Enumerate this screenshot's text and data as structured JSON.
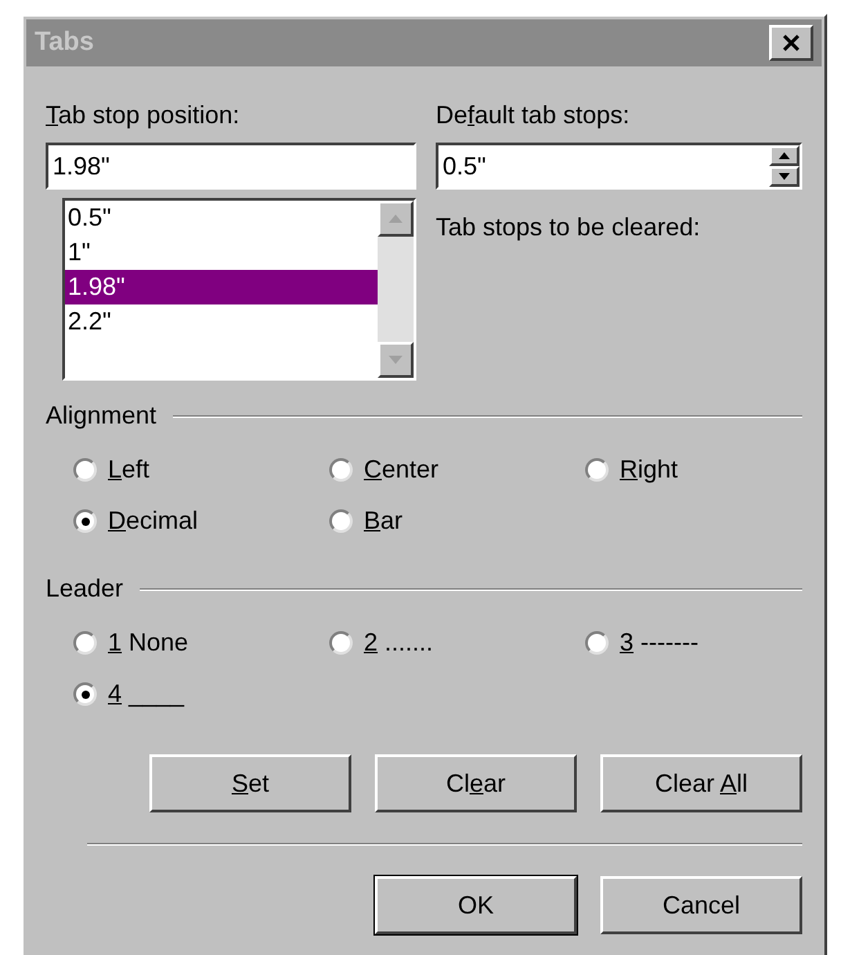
{
  "window": {
    "title": "Tabs",
    "active": false
  },
  "tab_stop_position": {
    "label": [
      {
        "text": "T",
        "underlined": true
      },
      {
        "text": "ab stop position:",
        "underlined": false
      }
    ],
    "value": "1.98\""
  },
  "tab_stops": [
    {
      "label": "0.5\"",
      "selected": false
    },
    {
      "label": "1\"",
      "selected": false
    },
    {
      "label": "1.98\"",
      "selected": true
    },
    {
      "label": "2.2\"",
      "selected": false
    }
  ],
  "default_tab_stops": {
    "label": [
      {
        "text": "De",
        "underlined": false
      },
      {
        "text": "f",
        "underlined": true
      },
      {
        "text": "ault tab stops:",
        "underlined": false
      }
    ],
    "value": "0.5\""
  },
  "tab_stops_to_be_cleared": {
    "label": "Tab stops to be cleared:"
  },
  "alignment": {
    "label": "Alignment",
    "options": [
      {
        "label": [
          {
            "text": "L",
            "underlined": true
          },
          {
            "text": "eft",
            "underlined": false
          }
        ],
        "selected": false
      },
      {
        "label": [
          {
            "text": "C",
            "underlined": true
          },
          {
            "text": "enter",
            "underlined": false
          }
        ],
        "selected": false
      },
      {
        "label": [
          {
            "text": "R",
            "underlined": true
          },
          {
            "text": "ight",
            "underlined": false
          }
        ],
        "selected": false
      },
      {
        "label": [
          {
            "text": "D",
            "underlined": true
          },
          {
            "text": "ecimal",
            "underlined": false
          }
        ],
        "selected": true
      },
      {
        "label": [
          {
            "text": "B",
            "underlined": true
          },
          {
            "text": "ar",
            "underlined": false
          }
        ],
        "selected": false
      }
    ]
  },
  "leader": {
    "label": "Leader",
    "options": [
      {
        "label": [
          {
            "text": "1",
            "underlined": true
          },
          {
            "text": " None",
            "underlined": false
          }
        ],
        "selected": false
      },
      {
        "label": [
          {
            "text": "2",
            "underlined": true
          },
          {
            "text": " .......",
            "underlined": false
          }
        ],
        "selected": false
      },
      {
        "label": [
          {
            "text": "3",
            "underlined": true
          },
          {
            "text": " -------",
            "underlined": false
          }
        ],
        "selected": false
      },
      {
        "label": [
          {
            "text": "4",
            "underlined": true
          },
          {
            "text": " ____",
            "underlined": false
          }
        ],
        "selected": true
      }
    ]
  },
  "action_buttons": [
    {
      "label": [
        {
          "text": "S",
          "underlined": true
        },
        {
          "text": "et",
          "underlined": false
        }
      ],
      "default": false
    },
    {
      "label": [
        {
          "text": "Cl",
          "underlined": false
        },
        {
          "text": "e",
          "underlined": true
        },
        {
          "text": "ar",
          "underlined": false
        }
      ],
      "default": false
    },
    {
      "label": [
        {
          "text": "Clear ",
          "underlined": false
        },
        {
          "text": "A",
          "underlined": true
        },
        {
          "text": "ll",
          "underlined": false
        }
      ],
      "default": false
    }
  ],
  "dialog_buttons": [
    {
      "label": [
        {
          "text": "OK",
          "underlined": false
        }
      ],
      "default": true
    },
    {
      "label": [
        {
          "text": "Cancel",
          "underlined": false
        }
      ],
      "default": false
    }
  ]
}
